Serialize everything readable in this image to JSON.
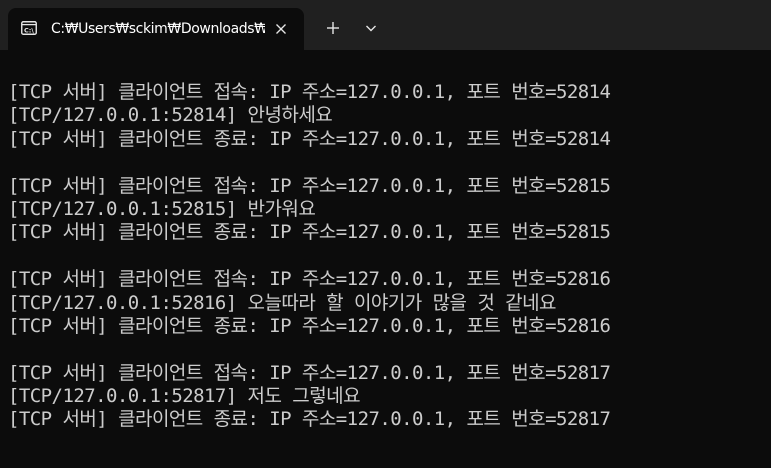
{
  "window": {
    "tab": {
      "title": "C:₩Users₩sckim₩Downloads₩",
      "icon": "terminal-prompt-icon",
      "close_icon": "close-icon"
    },
    "new_tab_icon": "plus-icon",
    "dropdown_icon": "chevron-down-icon",
    "colors": {
      "titlebar_bg": "#202020",
      "terminal_bg": "#0c0c0c",
      "terminal_fg": "#cccccc"
    }
  },
  "terminal": {
    "lines": [
      "[TCP 서버] 클라이언트 접속: IP 주소=127.0.0.1, 포트 번호=52814",
      "[TCP/127.0.0.1:52814] 안녕하세요",
      "[TCP 서버] 클라이언트 종료: IP 주소=127.0.0.1, 포트 번호=52814",
      "",
      "[TCP 서버] 클라이언트 접속: IP 주소=127.0.0.1, 포트 번호=52815",
      "[TCP/127.0.0.1:52815] 반가워요",
      "[TCP 서버] 클라이언트 종료: IP 주소=127.0.0.1, 포트 번호=52815",
      "",
      "[TCP 서버] 클라이언트 접속: IP 주소=127.0.0.1, 포트 번호=52816",
      "[TCP/127.0.0.1:52816] 오늘따라 할 이야기가 많을 것 같네요",
      "[TCP 서버] 클라이언트 종료: IP 주소=127.0.0.1, 포트 번호=52816",
      "",
      "[TCP 서버] 클라이언트 접속: IP 주소=127.0.0.1, 포트 번호=52817",
      "[TCP/127.0.0.1:52817] 저도 그렇네요",
      "[TCP 서버] 클라이언트 종료: IP 주소=127.0.0.1, 포트 번호=52817"
    ]
  }
}
